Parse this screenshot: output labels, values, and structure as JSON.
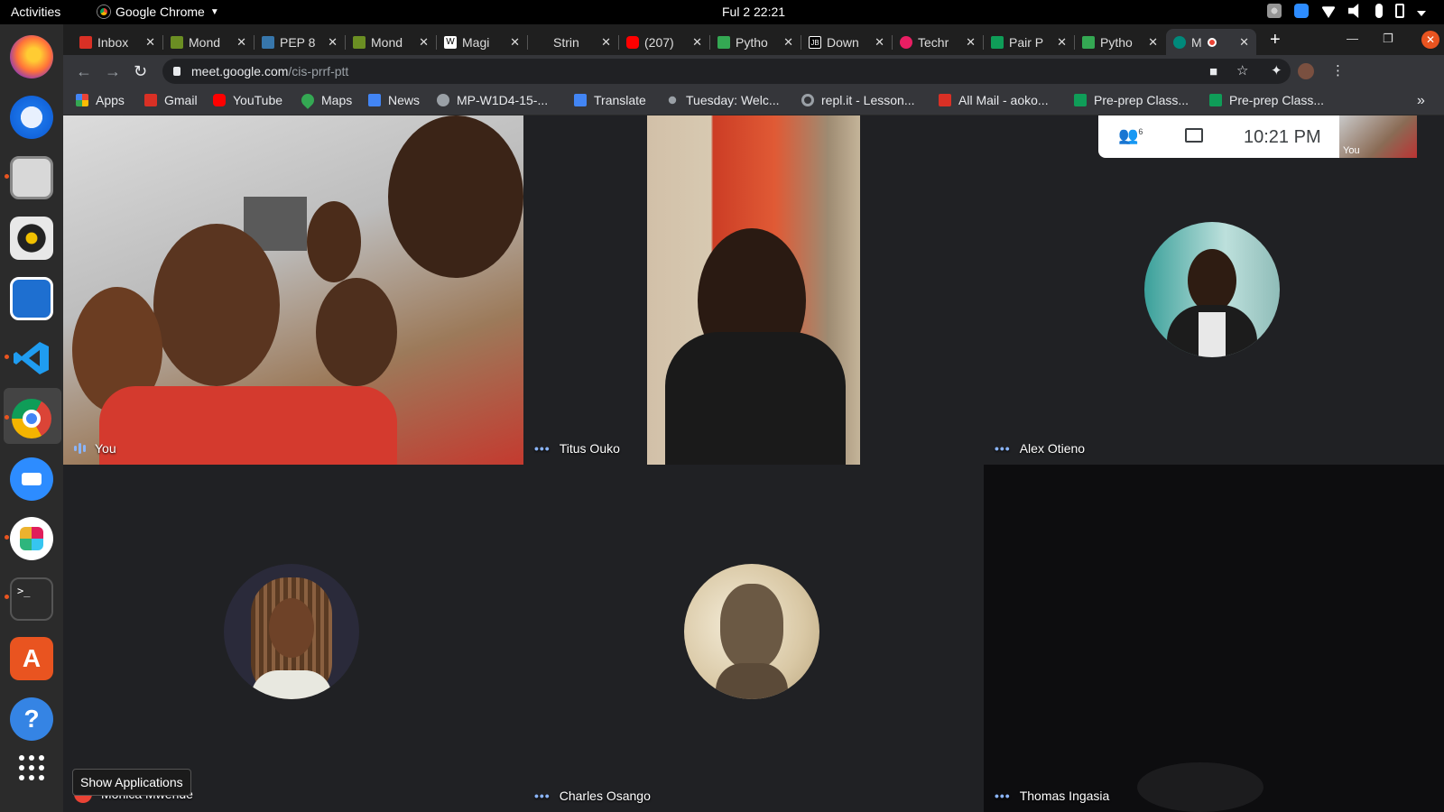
{
  "system": {
    "activities": "Activities",
    "app_name": "Google Chrome",
    "clock": "Ful 2  22:21"
  },
  "tabs": [
    {
      "label": "Inbox",
      "icon": "gmail-icon",
      "color": "#d93025"
    },
    {
      "label": "Mond",
      "icon": "plant-icon",
      "color": "#6b8e23"
    },
    {
      "label": "PEP 8",
      "icon": "python-icon",
      "color": "#3776ab"
    },
    {
      "label": "Mond",
      "icon": "plant-icon",
      "color": "#6b8e23"
    },
    {
      "label": "Magi",
      "icon": "wikipedia-icon",
      "color": "#ffffff"
    },
    {
      "label": "Strin",
      "icon": "blank-icon",
      "color": "#1f1f1f"
    },
    {
      "label": "(207)",
      "icon": "youtube-icon",
      "color": "#ff0000"
    },
    {
      "label": "Pytho",
      "icon": "chart-icon",
      "color": "#34a853"
    },
    {
      "label": "Down",
      "icon": "jetbrains-icon",
      "color": "#000000"
    },
    {
      "label": "Techr",
      "icon": "record-icon",
      "color": "#e91e63"
    },
    {
      "label": "Pair P",
      "icon": "sheets-icon",
      "color": "#0f9d58"
    },
    {
      "label": "Pytho",
      "icon": "chart-icon",
      "color": "#34a853"
    },
    {
      "label": "M",
      "icon": "meet-icon",
      "color": "#00897b",
      "active": true
    }
  ],
  "toolbar": {
    "url_host": "meet.google.com",
    "url_path": "/cis-prrf-ptt"
  },
  "bookmarks": [
    {
      "label": "Apps",
      "icon": "apps-grid-icon",
      "color": "#ea4335"
    },
    {
      "label": "Gmail",
      "icon": "gmail-icon",
      "color": "#d93025"
    },
    {
      "label": "YouTube",
      "icon": "youtube-icon",
      "color": "#ff0000"
    },
    {
      "label": "Maps",
      "icon": "maps-pin-icon",
      "color": "#34a853"
    },
    {
      "label": "News",
      "icon": "news-icon",
      "color": "#4285f4"
    },
    {
      "label": "MP-W1D4-15-...",
      "icon": "globe-icon",
      "color": "#9aa0a6"
    },
    {
      "label": "Translate",
      "icon": "translate-icon",
      "color": "#4285f4"
    },
    {
      "label": "Tuesday: Welc...",
      "icon": "plant-icon",
      "color": "#9aa0a6"
    },
    {
      "label": "repl.it - Lesson...",
      "icon": "replit-icon",
      "color": "#9aa0a6"
    },
    {
      "label": "All Mail - aoko...",
      "icon": "gmail-icon",
      "color": "#d93025"
    },
    {
      "label": "Pre-prep Class...",
      "icon": "sheets-icon",
      "color": "#0f9d58"
    },
    {
      "label": "Pre-prep Class...",
      "icon": "sheets-icon",
      "color": "#0f9d58"
    }
  ],
  "meet": {
    "participant_count": "6",
    "time": "10:21  PM",
    "self_label": "You",
    "participants": [
      {
        "name": "You"
      },
      {
        "name": "Titus Ouko"
      },
      {
        "name": "Alex Otieno"
      },
      {
        "name": "Monica Mwende"
      },
      {
        "name": "Charles Osango"
      },
      {
        "name": "Thomas Ingasia"
      }
    ]
  },
  "dock": {
    "tooltip": "Show Applications",
    "apps": [
      "firefox-icon",
      "thunderbird-icon",
      "files-icon",
      "rhythmbox-icon",
      "writer-icon",
      "vscode-icon",
      "chrome-icon",
      "zoom-icon",
      "slack-icon",
      "terminal-icon",
      "software-icon",
      "help-icon",
      "show-apps-icon"
    ]
  }
}
